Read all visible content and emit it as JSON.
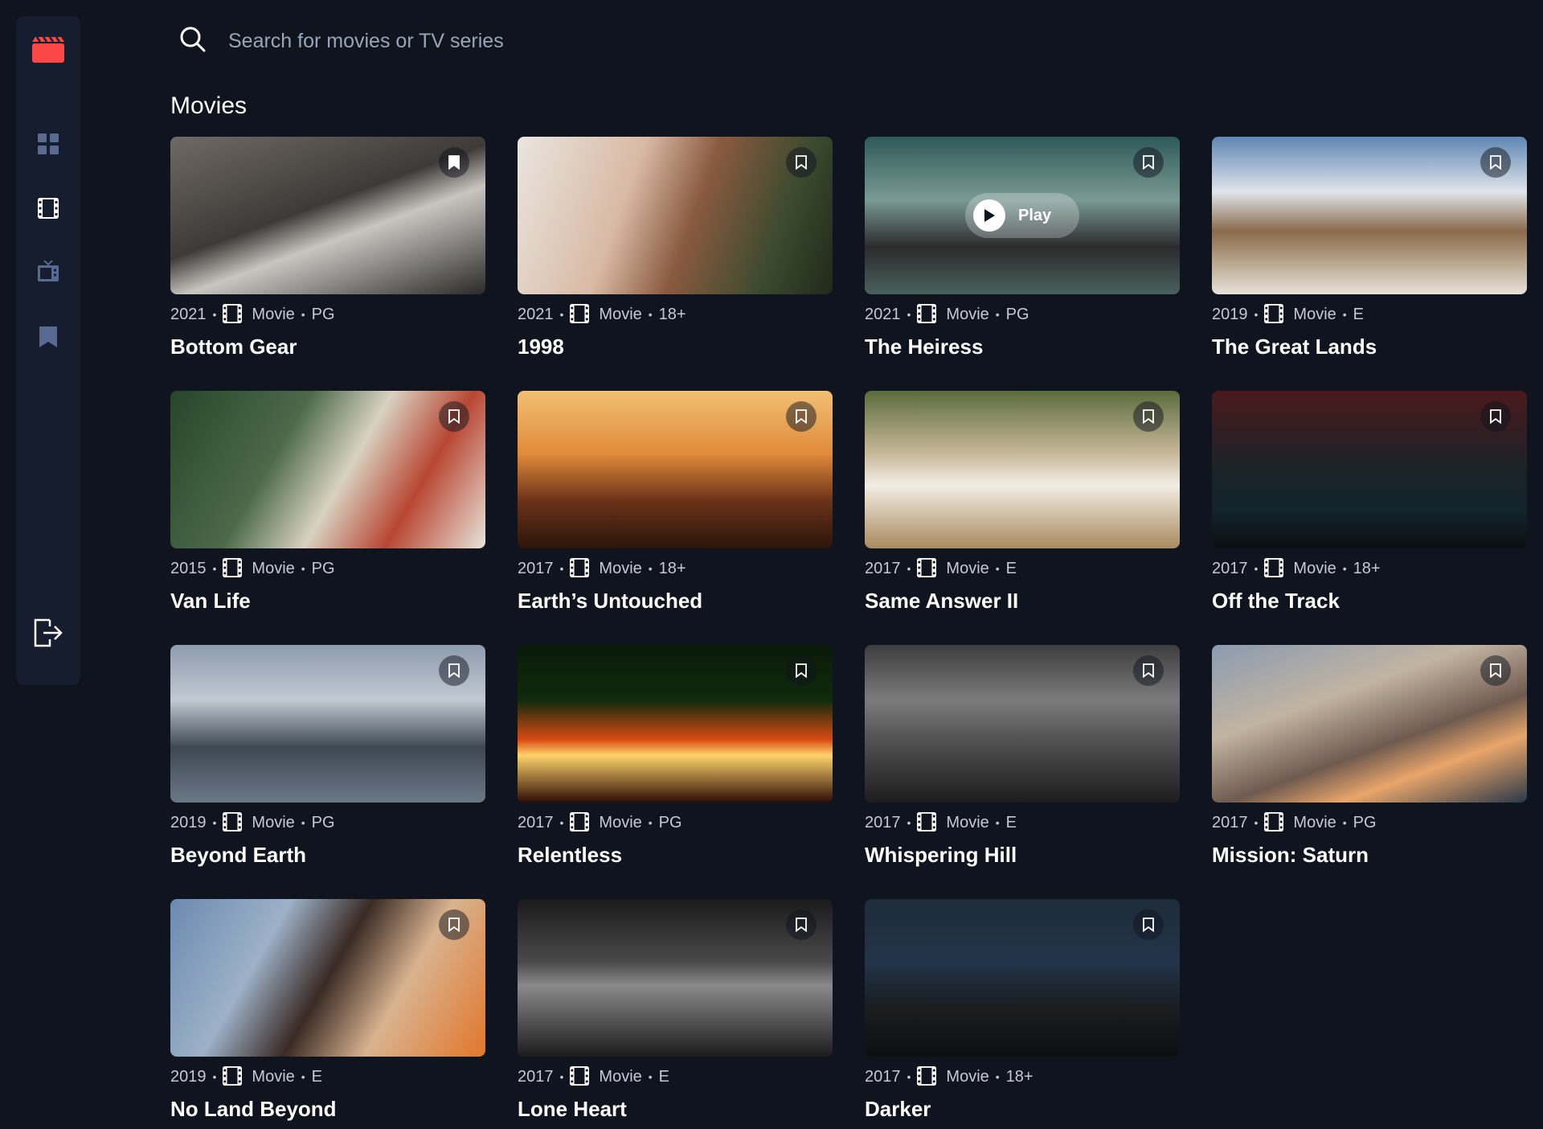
{
  "search": {
    "placeholder": "Search for movies or TV series"
  },
  "section": {
    "title": "Movies"
  },
  "colors": {
    "accent": "#fc4747",
    "background": "#10141e",
    "sidebar": "#161d2f",
    "nav_inactive": "#5a698f"
  },
  "icons": {
    "logo": "clapperboard-icon",
    "home": "grid-icon",
    "movies": "film-icon",
    "tv": "tv-icon",
    "bookmarks": "bookmark-icon",
    "logout": "logout-icon",
    "search": "search-icon"
  },
  "play_label": "Play",
  "movies": [
    {
      "year": "2021",
      "category": "Movie",
      "rating": "PG",
      "title": "Bottom Gear"
    },
    {
      "year": "2021",
      "category": "Movie",
      "rating": "18+",
      "title": "1998"
    },
    {
      "year": "2021",
      "category": "Movie",
      "rating": "PG",
      "title": "The Heiress"
    },
    {
      "year": "2019",
      "category": "Movie",
      "rating": "E",
      "title": "The Great Lands"
    },
    {
      "year": "2015",
      "category": "Movie",
      "rating": "PG",
      "title": "Van Life"
    },
    {
      "year": "2017",
      "category": "Movie",
      "rating": "18+",
      "title": "Earth’s Untouched"
    },
    {
      "year": "2017",
      "category": "Movie",
      "rating": "E",
      "title": "Same Answer II"
    },
    {
      "year": "2017",
      "category": "Movie",
      "rating": "18+",
      "title": "Off the Track"
    },
    {
      "year": "2019",
      "category": "Movie",
      "rating": "PG",
      "title": "Beyond Earth"
    },
    {
      "year": "2017",
      "category": "Movie",
      "rating": "PG",
      "title": "Relentless"
    },
    {
      "year": "2017",
      "category": "Movie",
      "rating": "E",
      "title": "Whispering Hill"
    },
    {
      "year": "2017",
      "category": "Movie",
      "rating": "PG",
      "title": "Mission: Saturn"
    },
    {
      "year": "2019",
      "category": "Movie",
      "rating": "E",
      "title": "No Land Beyond"
    },
    {
      "year": "2017",
      "category": "Movie",
      "rating": "E",
      "title": "Lone Heart"
    },
    {
      "year": "2017",
      "category": "Movie",
      "rating": "18+",
      "title": "Darker"
    }
  ]
}
